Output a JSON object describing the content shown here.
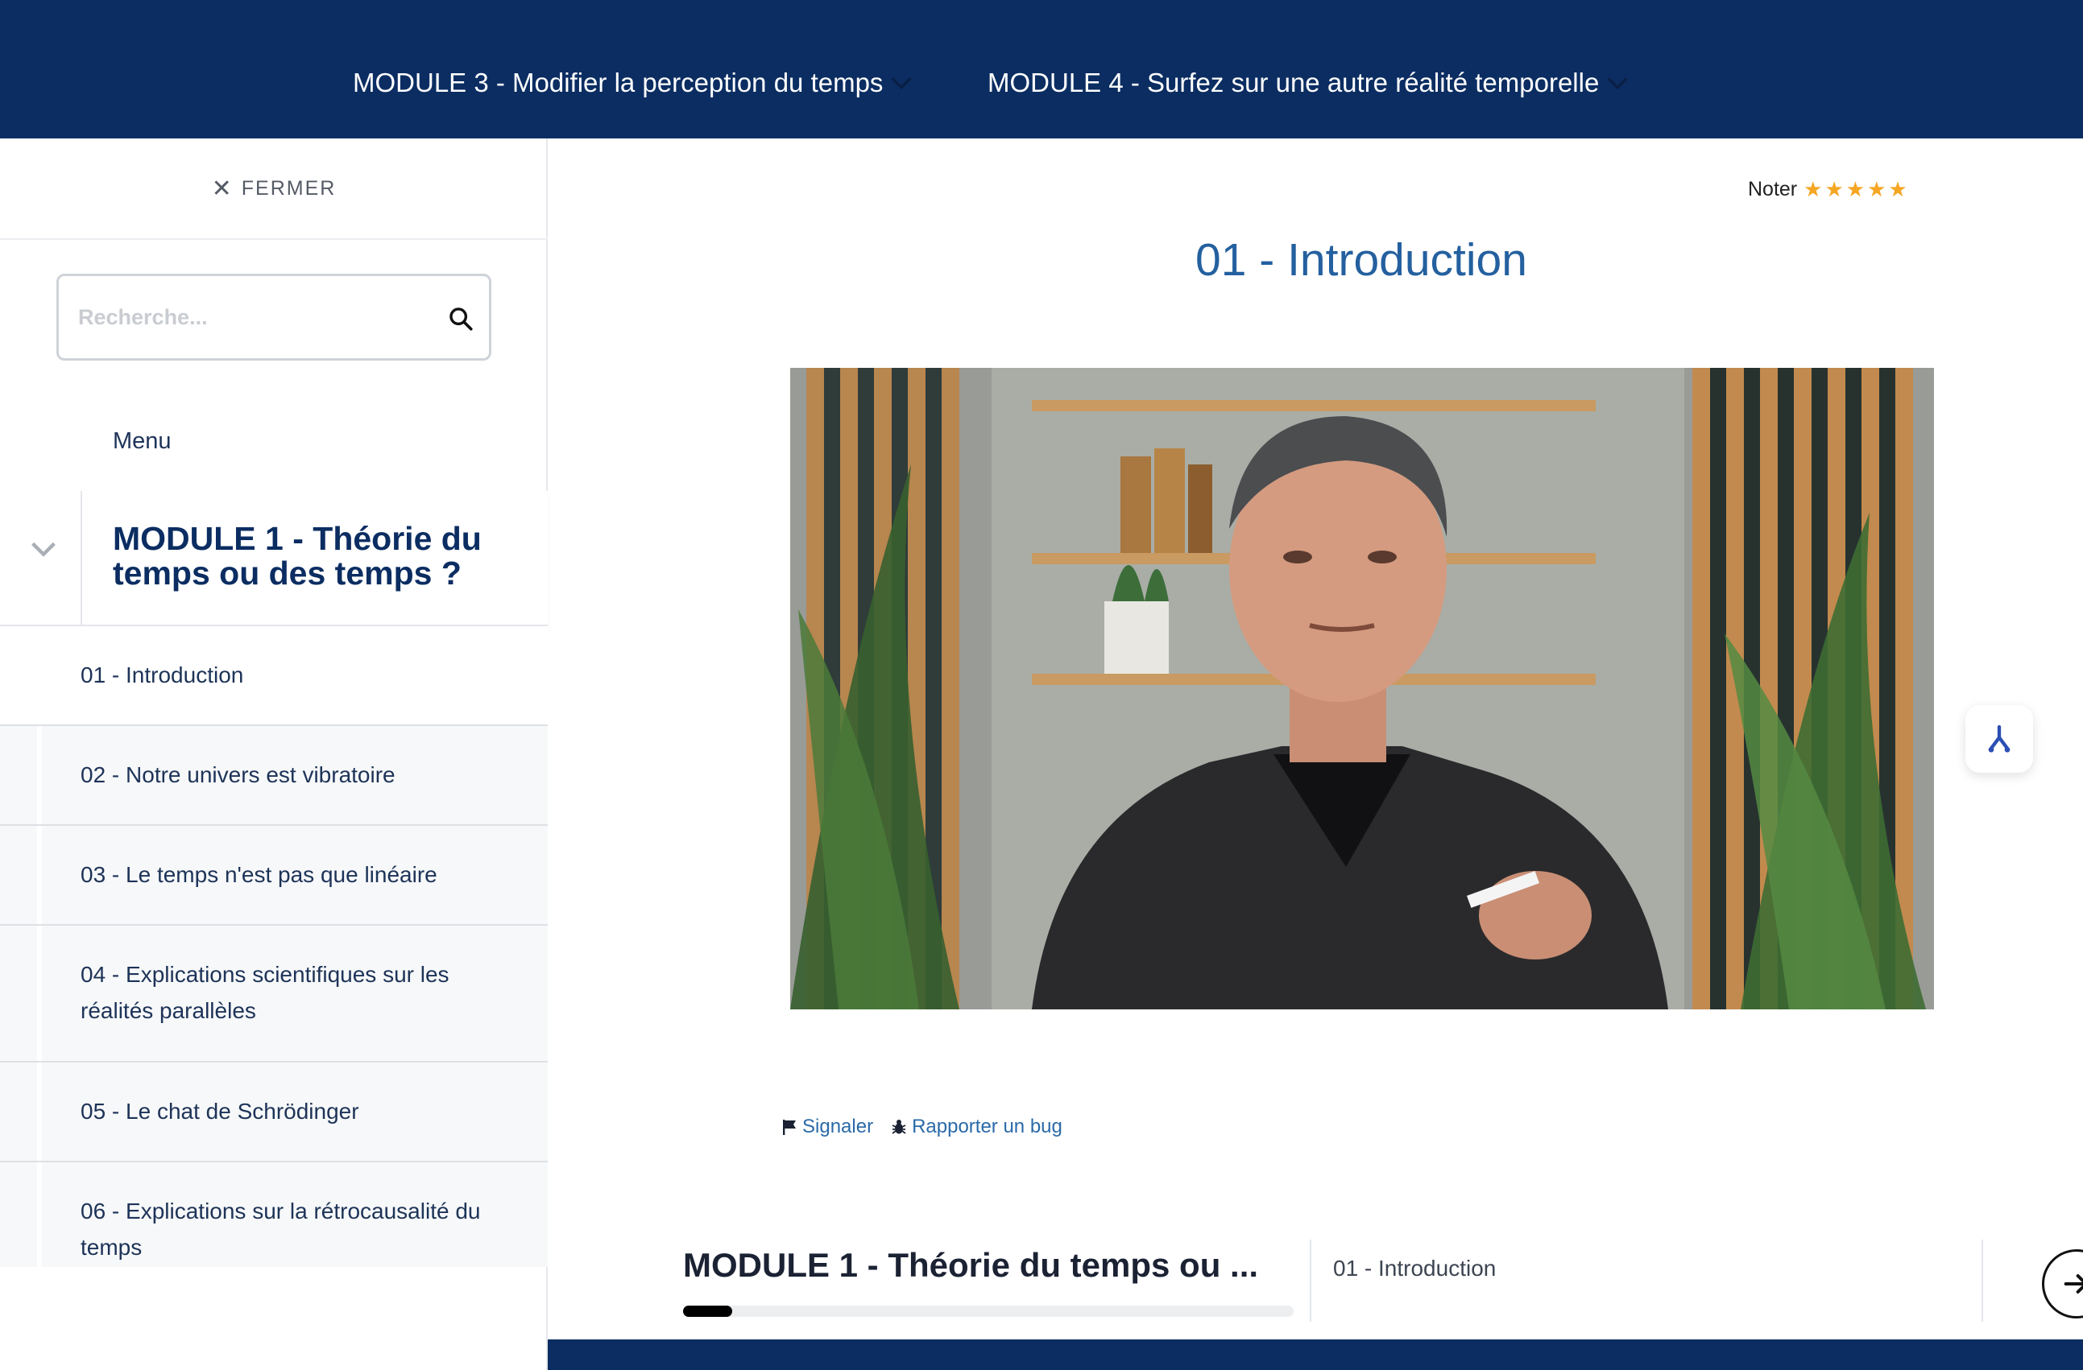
{
  "topnav": {
    "module3": "MODULE 3 - Modifier la perception du temps",
    "module4": "MODULE 4 - Surfez sur une autre réalité temporelle"
  },
  "sidebar": {
    "close_label": "FERMER",
    "search_placeholder": "Recherche...",
    "menu_label": "Menu",
    "module_title": "MODULE 1 - Théorie du temps ou des temps ?",
    "lessons": [
      "01 - Introduction",
      "02 - Notre univers est vibratoire",
      "03 - Le temps n'est pas que linéaire",
      "04 - Explications scientifiques sur les réalités parallèles",
      "05 - Le chat de Schrödinger",
      "06 - Explications sur la rétrocausalité du temps"
    ]
  },
  "main": {
    "rating_label": "Noter",
    "stars": "★★★★★",
    "title": "01 - Introduction",
    "report_label": "Signaler",
    "bug_label": "Rapporter un bug"
  },
  "footer": {
    "module_title": "MODULE 1 - Théorie du temps ou ...",
    "lesson_title": "01 - Introduction",
    "progress": 0.08
  },
  "colors": {
    "navy": "#0b2d62",
    "title_blue": "#24609f",
    "link_blue": "#2a6aa8",
    "star": "#f5a623"
  },
  "icons": [
    "chevron-down-icon",
    "close-icon",
    "search-icon",
    "flag-icon",
    "bug-icon",
    "arrow-right-icon",
    "tool-icon"
  ]
}
